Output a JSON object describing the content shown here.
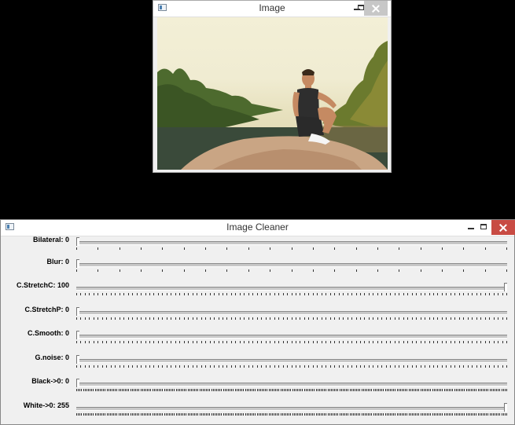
{
  "image_window": {
    "title": "Image",
    "photo_description_icon": "photo-person-on-rock-by-river"
  },
  "cleaner_window": {
    "title": "Image Cleaner",
    "trackbars": [
      {
        "label": "Bilateral: 0",
        "value": 0,
        "max": 30,
        "ticks": 20
      },
      {
        "label": "Blur: 0",
        "value": 0,
        "max": 30,
        "ticks": 20
      },
      {
        "label": "C.StretchC: 100",
        "value": 100,
        "max": 100,
        "ticks": 100
      },
      {
        "label": "C.StretchP: 0",
        "value": 0,
        "max": 100,
        "ticks": 100
      },
      {
        "label": "C.Smooth: 0",
        "value": 0,
        "max": 100,
        "ticks": 100
      },
      {
        "label": "G.noise: 0",
        "value": 0,
        "max": 100,
        "ticks": 100
      },
      {
        "label": "Black->0: 0",
        "value": 0,
        "max": 255,
        "ticks": 255
      },
      {
        "label": "White->0: 255",
        "value": 255,
        "max": 255,
        "ticks": 255
      }
    ]
  },
  "colors": {
    "close_red": "#c84b43",
    "background": "#000000"
  }
}
